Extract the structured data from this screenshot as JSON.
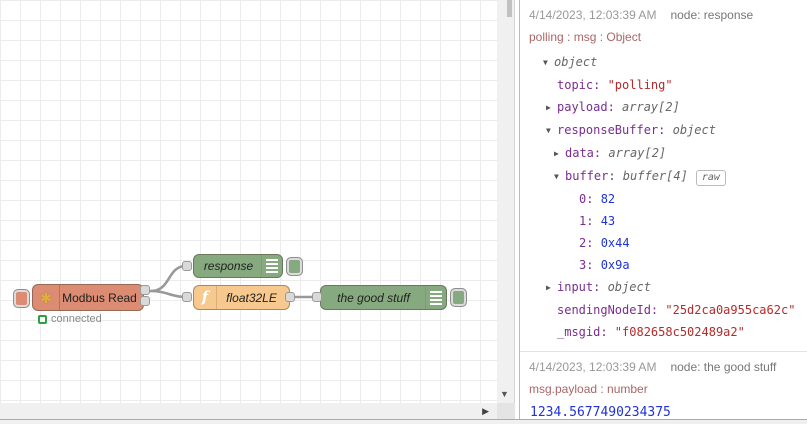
{
  "colors": {
    "modbus_node": "#db8c72",
    "debug_node": "#87a980",
    "function_node": "#f8c98e",
    "status_green": "#2f9e44",
    "wire": "#999999",
    "key_purple": "#792e90",
    "string_red": "#b52a2a",
    "number_blue": "#2033d6",
    "meta_red": "#aa6666"
  },
  "canvas": {
    "nodes": {
      "modbus": {
        "label": "Modbus Read",
        "status": "connected",
        "icon": "modbus-asterisk"
      },
      "response": {
        "label": "response",
        "icon": "debug-list"
      },
      "func": {
        "label": "float32LE",
        "icon": "function-f"
      },
      "goodstuff": {
        "label": "the good stuff",
        "icon": "debug-list"
      }
    }
  },
  "debug": {
    "messages": [
      {
        "timestamp": "4/14/2023, 12:03:39 AM",
        "node_name": "node: response",
        "meta": "polling : msg : Object",
        "tree": [
          {
            "arrow": "down",
            "indent": 0,
            "key": "",
            "value": "object",
            "type": "meta"
          },
          {
            "arrow": "none",
            "indent": 1,
            "key": "topic",
            "value": "\"polling\"",
            "type": "string"
          },
          {
            "arrow": "right",
            "indent": 1,
            "key": "payload",
            "value": "array[2]",
            "type": "meta"
          },
          {
            "arrow": "down",
            "indent": 1,
            "key": "responseBuffer",
            "value": "object",
            "type": "meta"
          },
          {
            "arrow": "right",
            "indent": 2,
            "key": "data",
            "value": "array[2]",
            "type": "meta"
          },
          {
            "arrow": "down",
            "indent": 2,
            "key": "buffer",
            "value": "buffer[4]",
            "type": "meta",
            "badge": "raw"
          },
          {
            "arrow": "none",
            "indent": 3,
            "key": "0",
            "value": "82",
            "type": "number"
          },
          {
            "arrow": "none",
            "indent": 3,
            "key": "1",
            "value": "43",
            "type": "number"
          },
          {
            "arrow": "none",
            "indent": 3,
            "key": "2",
            "value": "0x44",
            "type": "number"
          },
          {
            "arrow": "none",
            "indent": 3,
            "key": "3",
            "value": "0x9a",
            "type": "number"
          },
          {
            "arrow": "right",
            "indent": 1,
            "key": "input",
            "value": "object",
            "type": "meta"
          },
          {
            "arrow": "none",
            "indent": 1,
            "key": "sendingNodeId",
            "value": "\"25d2ca0a955ca62c\"",
            "type": "string"
          },
          {
            "arrow": "none",
            "indent": 1,
            "key": "_msgid",
            "value": "\"f082658c502489a2\"",
            "type": "string"
          }
        ]
      },
      {
        "timestamp": "4/14/2023, 12:03:39 AM",
        "node_name": "node: the good stuff",
        "meta": "msg.payload : number",
        "value": "1234.5677490234375"
      }
    ]
  }
}
